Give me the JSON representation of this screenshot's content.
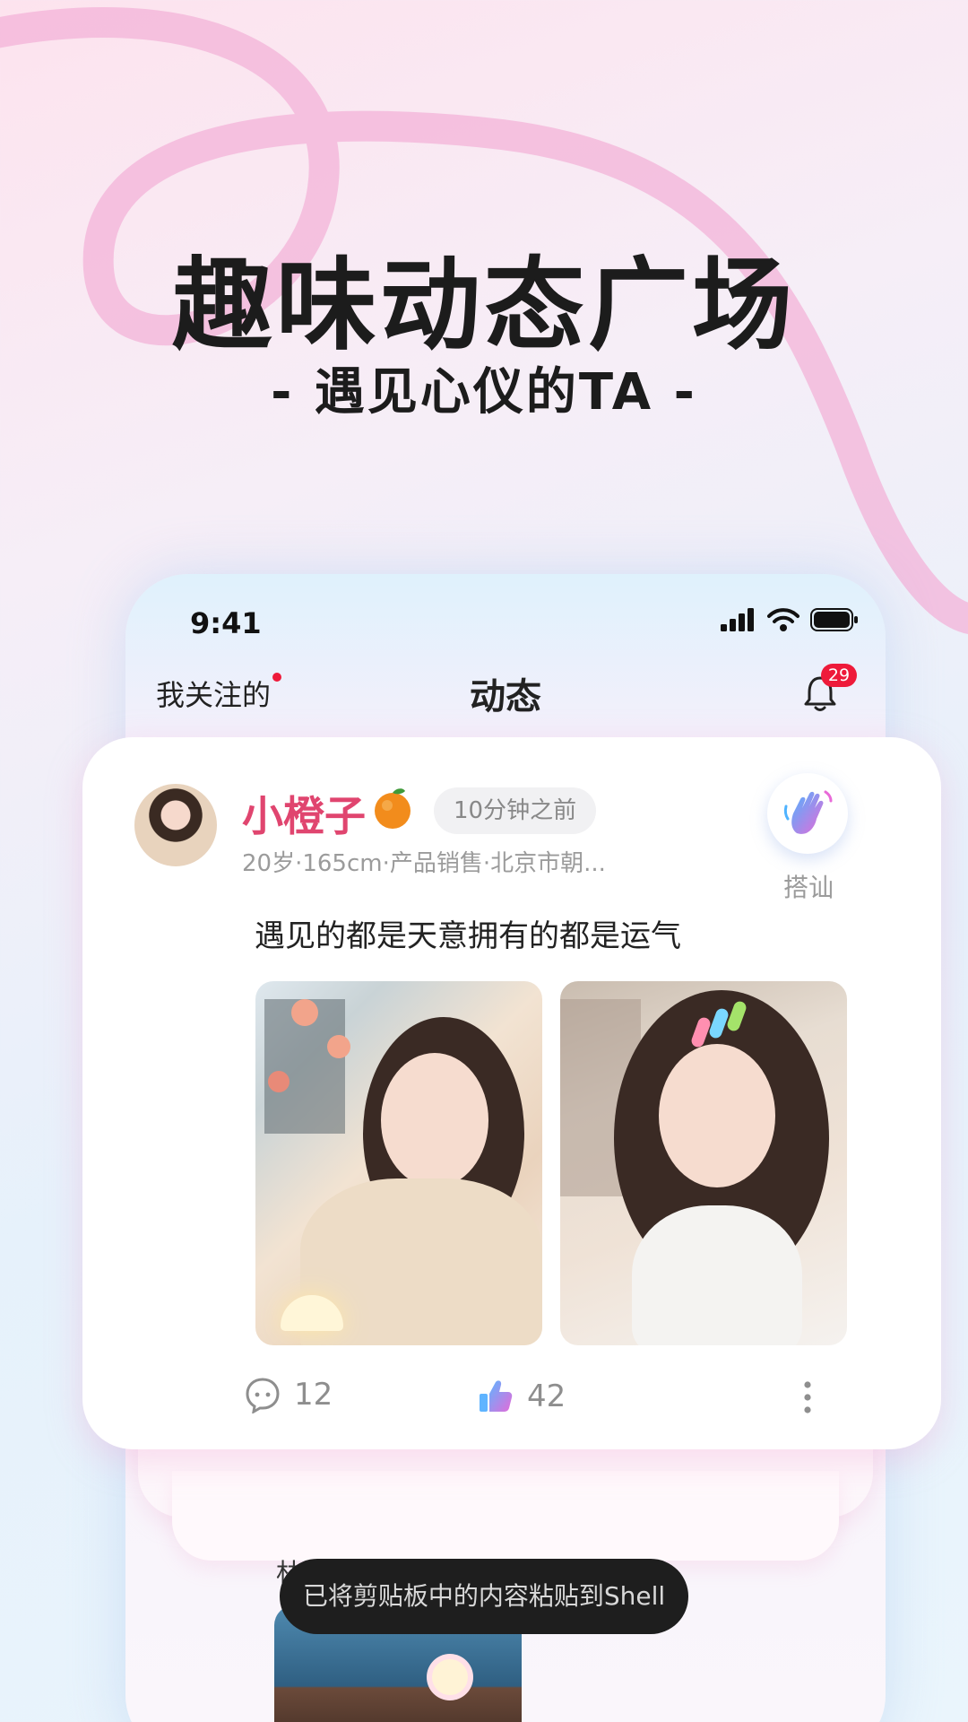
{
  "hero": {
    "title": "趣味动态广场",
    "subtitle": "-  遇见心仪的TA  -"
  },
  "status_bar": {
    "time": "9:41",
    "icons": [
      "signal-icon",
      "wifi-icon",
      "battery-icon"
    ]
  },
  "nav": {
    "left_label": "我关注的",
    "title": "动态",
    "notification_count": "29"
  },
  "post": {
    "user_name": "小橙子",
    "time_ago": "10分钟之前",
    "meta": "20岁·165cm·产品销售·北京市朝...",
    "greet_label": "搭讪",
    "text": "遇见的都是天意拥有的都是运气",
    "comment_count": "12",
    "like_count": "42"
  },
  "next_post": {
    "text_fragment": "林"
  },
  "toast": {
    "message": "已将剪贴板中的内容粘贴到Shell"
  },
  "colors": {
    "accent_pink": "#e0456f",
    "badge_red": "#ee1a3a",
    "swirl_pink": "#f3b3d8"
  }
}
